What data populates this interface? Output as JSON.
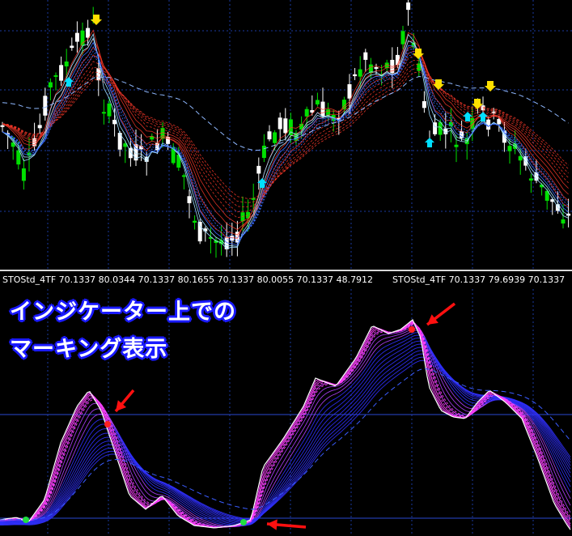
{
  "indicator_bar": {
    "segments": [
      "STOStd_4TF 70.1337 80.0344 70.1337 80.1655 70.1337 80.0055 70.1337 48.7912",
      "STOStd_4TF 70.1337 79.6939 70.1337"
    ]
  },
  "annotation": {
    "line1": "インジケーター上での",
    "line2": "マーキング表示"
  },
  "colors": {
    "background": "#000000",
    "bull_candle": "#00e000",
    "bear_candle": "#ffffff",
    "grid": "#1a3aa0",
    "marker_top": "#ff2020",
    "marker_bottom": "#20e040",
    "signal_arrow_up": "#00e0ff",
    "signal_arrow_down": "#ffe000",
    "callout_arrow": "#ff1010"
  }
}
